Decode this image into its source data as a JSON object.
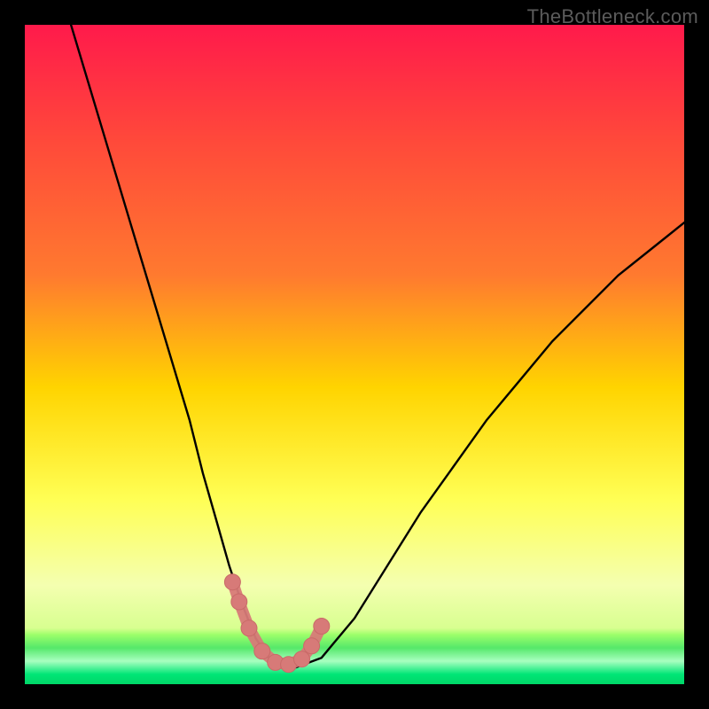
{
  "watermark": "TheBottleneck.com",
  "colors": {
    "frame": "#000000",
    "curve": "#000000",
    "marker_fill": "#d77a78",
    "marker_stroke": "#c96a68",
    "grad_top": "#ff1a4b",
    "grad_q1": "#ff7a2f",
    "grad_mid": "#ffd400",
    "grad_q3": "#ffff55",
    "grad_low": "#f4ffb0",
    "grad_band": "#9cff6a",
    "grad_bottom": "#00e676"
  },
  "chart_data": {
    "type": "line",
    "title": "",
    "xlabel": "",
    "ylabel": "",
    "xlim": [
      0,
      100
    ],
    "ylim": [
      0,
      100
    ],
    "series": [
      {
        "name": "bottleneck-curve",
        "x": [
          7,
          10,
          13,
          16,
          19,
          22,
          25,
          27,
          29,
          31,
          33,
          35,
          37,
          39,
          41,
          45,
          50,
          55,
          60,
          65,
          70,
          75,
          80,
          85,
          90,
          95,
          100
        ],
        "y": [
          100,
          90,
          80,
          70,
          60,
          50,
          40,
          32,
          25,
          18,
          12,
          7,
          4,
          2.5,
          2.5,
          4,
          10,
          18,
          26,
          33,
          40,
          46,
          52,
          57,
          62,
          66,
          70
        ]
      }
    ],
    "markers": {
      "name": "highlight-points",
      "x": [
        31.5,
        32.5,
        34.0,
        36.0,
        38.0,
        40.0,
        42.0,
        43.5,
        45.0
      ],
      "y": [
        15.5,
        12.5,
        8.5,
        5.0,
        3.3,
        3.0,
        3.8,
        5.8,
        8.8
      ]
    },
    "annotations": []
  }
}
